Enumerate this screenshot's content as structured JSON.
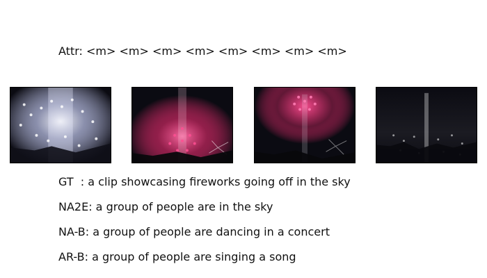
{
  "attr_line": "Attr: <m> <m> <m> <m> <m> <m> <m> <m>",
  "frames": [
    {
      "icon": "fireworks-burst-icon",
      "palette": "white-blue"
    },
    {
      "icon": "fireworks-burst-icon",
      "palette": "pink-red"
    },
    {
      "icon": "fireworks-burst-icon",
      "palette": "magenta-white"
    },
    {
      "icon": "fireworks-burst-icon",
      "palette": "white-gray"
    }
  ],
  "captions": [
    "GT  : a clip showcasing fireworks going off in the sky",
    "NA2E: a group of people are in the sky",
    "NA-B: a group of people are dancing in a concert",
    "AR-B: a group of people are singing a song"
  ]
}
